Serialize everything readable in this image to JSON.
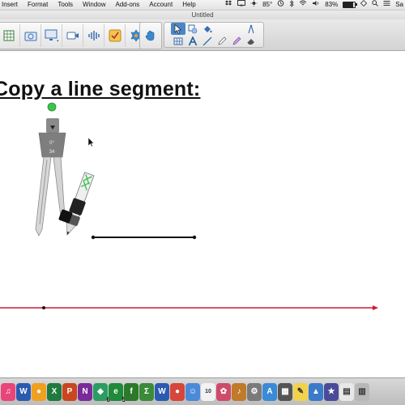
{
  "menubar": {
    "items": [
      "Insert",
      "Format",
      "Tools",
      "Window",
      "Add-ons",
      "Account",
      "Help"
    ],
    "temperature": "85°",
    "battery": "83%",
    "battery_level": 0.83,
    "user_truncated": "Sa"
  },
  "window": {
    "title": "Untitled"
  },
  "toolbar": {
    "left_icons": [
      "insert-table-icon",
      "camera-icon",
      "screen-capture-icon",
      "video-icon",
      "audio-icon",
      "mark-as-done-icon",
      "add-ons-icon"
    ],
    "middle_icons": [
      "hand-icon"
    ],
    "tool_grid": [
      "select-arrow-icon",
      "shape-select-icon",
      "fill-icon",
      "eraser-shape-icon",
      "pen-stylus-icon",
      "table-grid-icon",
      "text-icon",
      "line-icon",
      "pen-icon",
      "highlighter-icon",
      "eraser-icon"
    ],
    "active_tool": "select-arrow-icon"
  },
  "canvas": {
    "heading": "Copy a line segment:",
    "compass": {
      "angle_label": "0°",
      "radius_label": "34"
    },
    "colors": {
      "segment": "#111111",
      "number_line": "#cc1a33",
      "handle": "#3cc34a"
    }
  },
  "dock": {
    "apps": [
      {
        "name": "itunes-icon",
        "color": "#e8457a",
        "label": "♫"
      },
      {
        "name": "word-icon",
        "color": "#2b5bb0",
        "label": "W"
      },
      {
        "name": "browser-icon",
        "color": "#f0a020",
        "label": "●"
      },
      {
        "name": "excel-icon",
        "color": "#1f7a3e",
        "label": "X"
      },
      {
        "name": "powerpoint-icon",
        "color": "#c9461f",
        "label": "P"
      },
      {
        "name": "onenote-icon",
        "color": "#7a2a9a",
        "label": "N"
      },
      {
        "name": "geogebra-icon",
        "color": "#2b9d62",
        "label": "◆",
        "badge": "6"
      },
      {
        "name": "app-e-icon",
        "color": "#1e8a3a",
        "label": "e",
        "badge": "5"
      },
      {
        "name": "math-fx-icon",
        "color": "#2a7a2a",
        "label": "f"
      },
      {
        "name": "sigma-icon",
        "color": "#3a8a3a",
        "label": "Σ"
      },
      {
        "name": "word2-icon",
        "color": "#2b5bb0",
        "label": "W"
      },
      {
        "name": "chrome-icon",
        "color": "#d8453a",
        "label": "●"
      },
      {
        "name": "finder-icon",
        "color": "#4a8ad8",
        "label": "☺"
      },
      {
        "name": "calendar-icon",
        "color": "#f2f2f2",
        "label": "10"
      },
      {
        "name": "photos-icon",
        "color": "#d04a6a",
        "label": "✿"
      },
      {
        "name": "guitar-icon",
        "color": "#c07a2a",
        "label": "♪"
      },
      {
        "name": "settings-icon",
        "color": "#7a7a7a",
        "label": "⚙"
      },
      {
        "name": "app-store-icon",
        "color": "#3a8ad8",
        "label": "A"
      },
      {
        "name": "music-app-icon",
        "color": "#555555",
        "label": "▦"
      },
      {
        "name": "notes-icon",
        "color": "#f2d24a",
        "label": "✎"
      },
      {
        "name": "preview-icon",
        "color": "#3a7ac8",
        "label": "▲"
      },
      {
        "name": "star-app-icon",
        "color": "#4a4a9a",
        "label": "★"
      },
      {
        "name": "document-icon",
        "color": "#e8e8e8",
        "label": "▤"
      },
      {
        "name": "trash-icon",
        "color": "#b8b8b8",
        "label": "▥"
      }
    ]
  }
}
